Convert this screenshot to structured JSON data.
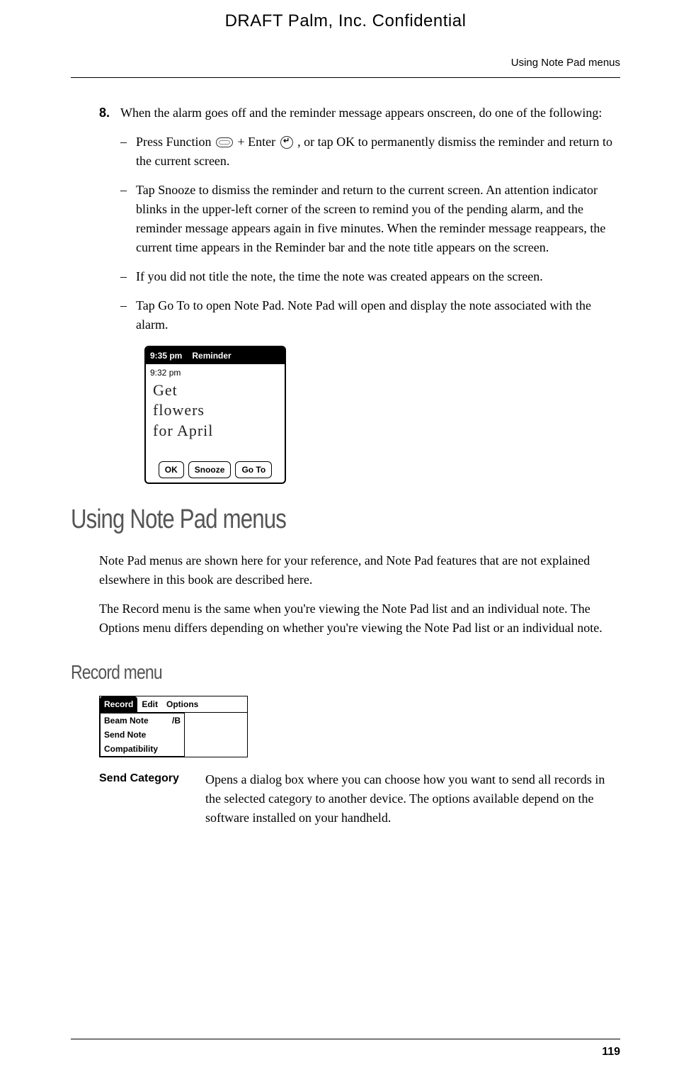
{
  "header": {
    "draft": "DRAFT   Palm, Inc. Confidential",
    "running_head": "Using Note Pad menus"
  },
  "step": {
    "number": "8.",
    "text": "When the alarm goes off and the reminder message appears onscreen, do one of the following:"
  },
  "sub_items": [
    {
      "prefix": "Press Function ",
      "mid": " + Enter ",
      "suffix": ", or tap OK to permanently dismiss the reminder and return to the current screen."
    },
    "Tap Snooze to dismiss the reminder and return to the current screen. An attention indicator blinks in the upper-left corner of the screen to remind you of the pending alarm, and the reminder message appears again in five minutes. When the reminder message reappears, the current time appears in the Reminder bar and the note title appears on the screen.",
    "If you did not title the note, the time the note was created appears on the screen.",
    "Tap Go To to open Note Pad. Note Pad will open and display the note associated with the alarm."
  ],
  "reminder_shot": {
    "title_time": "9:35 pm",
    "title_label": "Reminder",
    "note_time": "9:32 pm",
    "handwriting": "Get\nflowers\nfor April",
    "btn_ok": "OK",
    "btn_snooze": "Snooze",
    "btn_goto": "Go To"
  },
  "section1": {
    "heading": "Using Note Pad menus",
    "para1": "Note Pad menus are shown here for your reference, and Note Pad features that are not explained elsewhere in this book are described here.",
    "para2": "The Record menu is the same when you're viewing the Note Pad list and an individual note. The Options menu differs depending on whether you're viewing the Note Pad list or an individual note."
  },
  "section2": {
    "heading": "Record menu",
    "menubar": {
      "record": "Record",
      "edit": "Edit",
      "options": "Options"
    },
    "menu_items": [
      {
        "label": "Beam Note",
        "shortcut": "/B"
      },
      {
        "label": "Send Note",
        "shortcut": ""
      },
      {
        "label": "Compatibility",
        "shortcut": ""
      }
    ],
    "def_term": "Send Category",
    "def_desc": "Opens a dialog box where you can choose how you want to send all records in the selected category to another device. The options available depend on the software installed on your handheld."
  },
  "footer": {
    "page_number": "119"
  }
}
